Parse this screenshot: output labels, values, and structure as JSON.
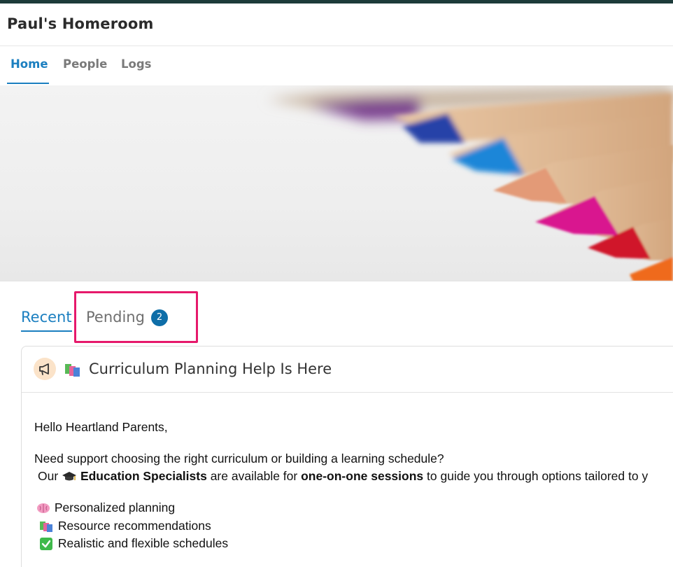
{
  "app": {
    "title": "Paul's Homeroom"
  },
  "nav": {
    "tabs": [
      {
        "label": "Home"
      },
      {
        "label": "People"
      },
      {
        "label": "Logs"
      }
    ]
  },
  "posts_tabs": {
    "recent": "Recent",
    "pending": "Pending",
    "pending_count": "2"
  },
  "post": {
    "title": "Curriculum Planning Help Is Here",
    "greeting": "Hello Heartland Parents,",
    "line1": "Need support choosing the right curriculum or building a learning schedule?",
    "line2_pre": "Our",
    "line2_bold1": "Education Specialists",
    "line2_mid": "are available for",
    "line2_bold2": "one-on-one sessions",
    "line2_post": "to guide you through options tailored to y",
    "bullets": [
      {
        "icon": "brain-icon",
        "text": "Personalized planning"
      },
      {
        "icon": "books-icon",
        "text": "Resource recommendations"
      },
      {
        "icon": "check-icon",
        "text": "Realistic and flexible schedules"
      }
    ]
  },
  "colors": {
    "accent": "#1b7fc0",
    "badge": "#0e6ea8",
    "highlight": "#e6196b",
    "top_strip": "#1d3b3a"
  }
}
